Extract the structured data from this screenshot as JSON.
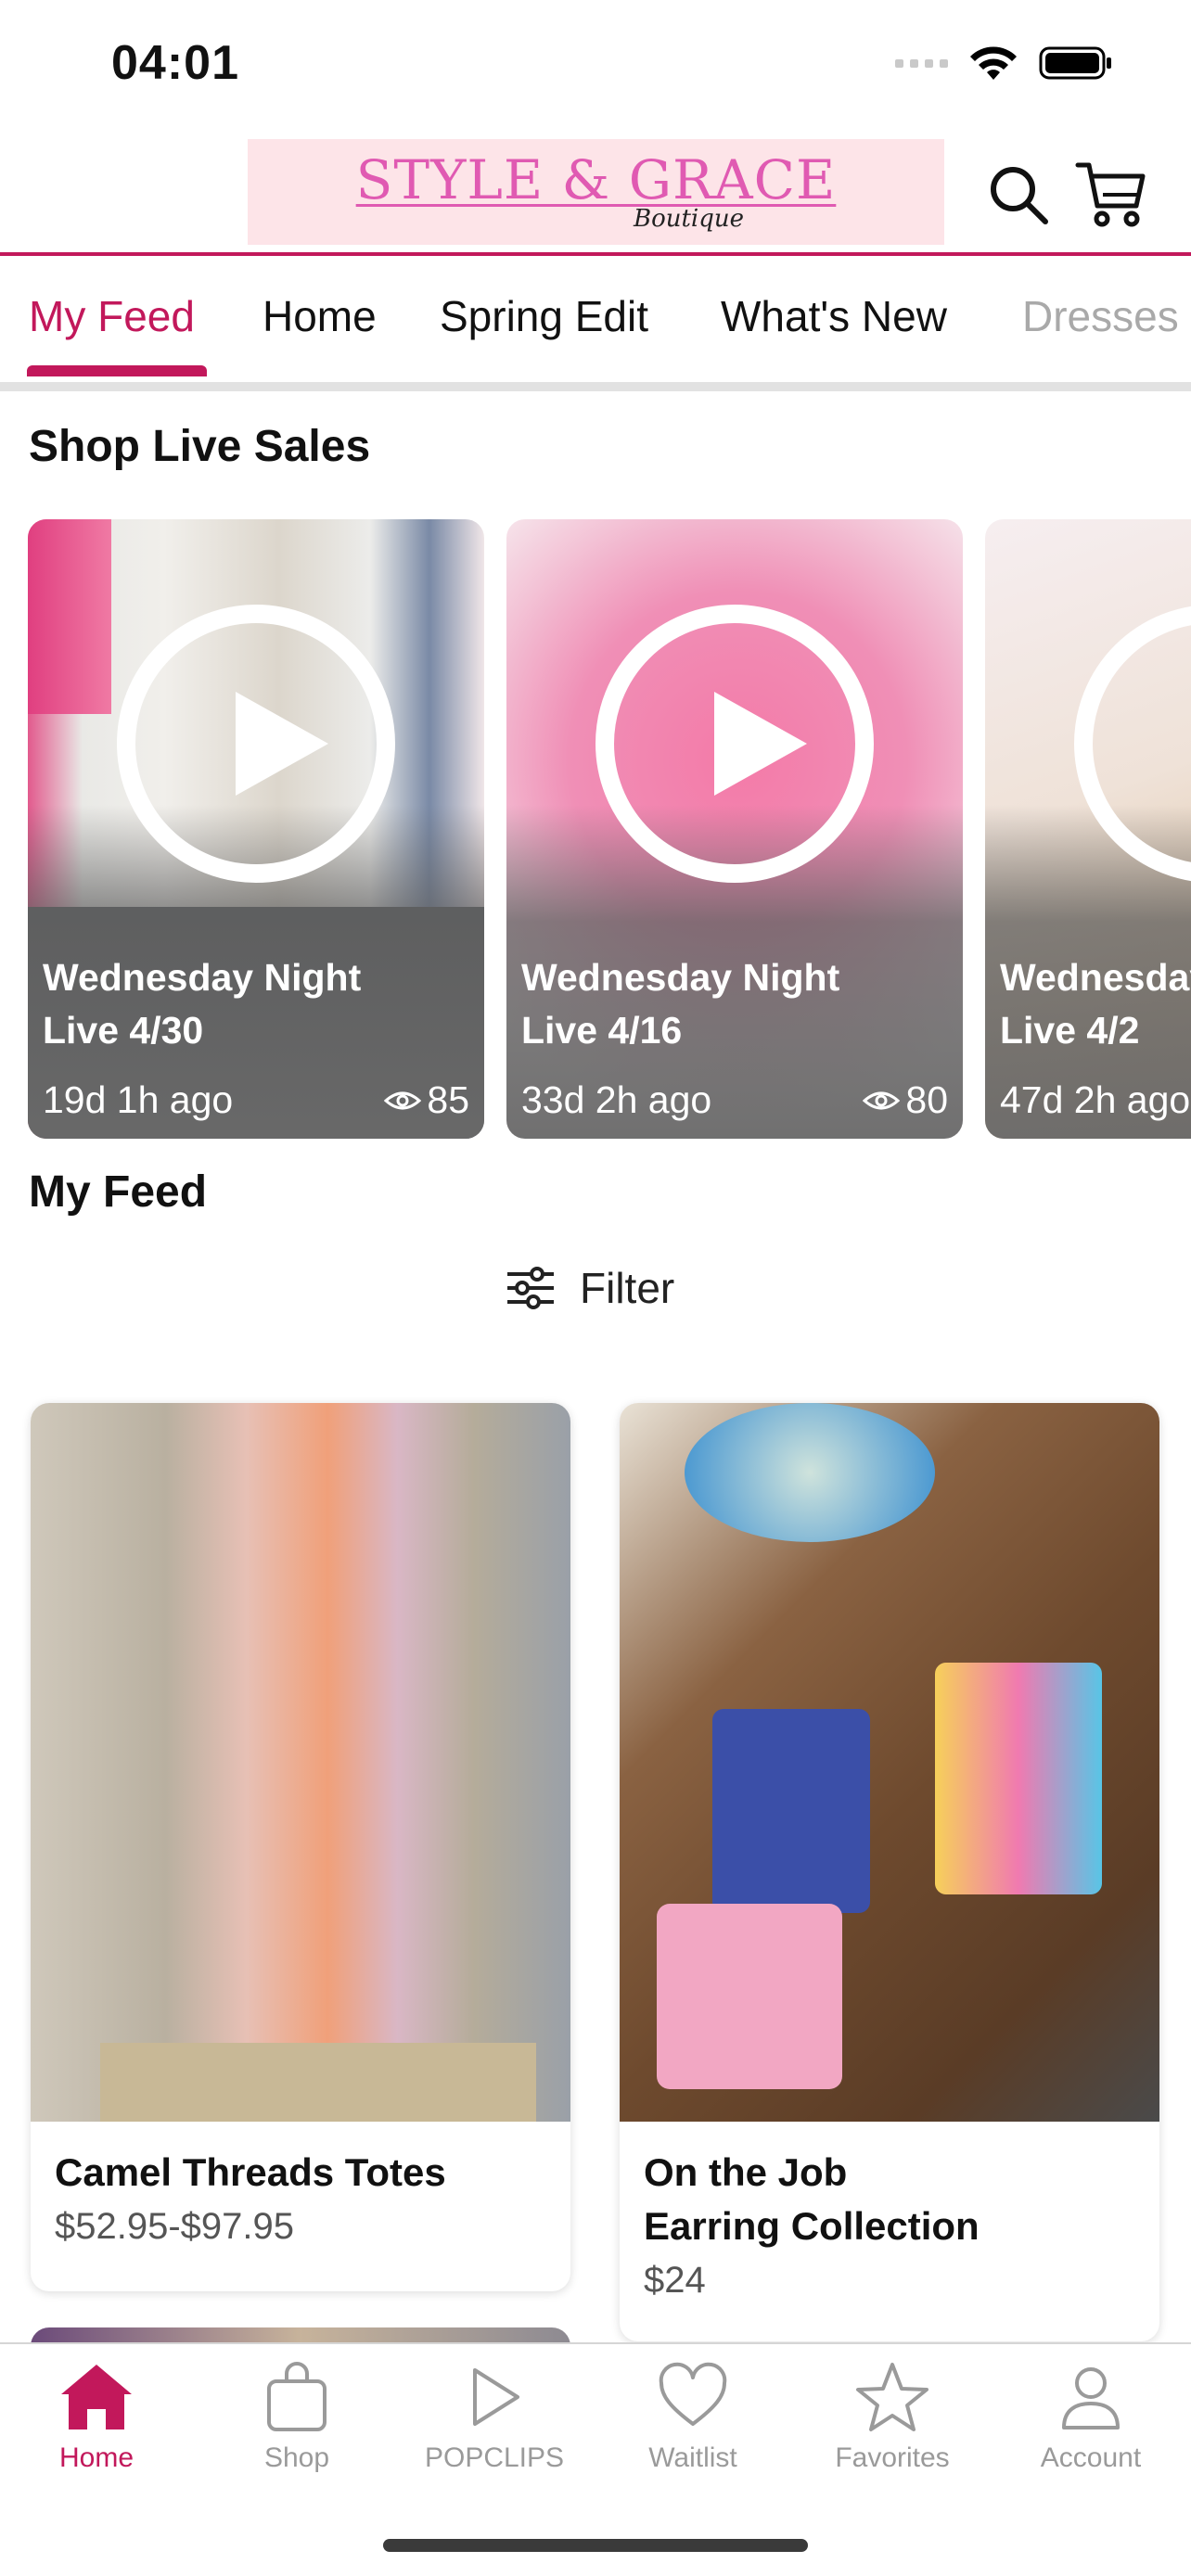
{
  "status_bar": {
    "time": "04:01"
  },
  "header": {
    "logo_main": "STYLE & GRACE",
    "logo_sub": "Boutique"
  },
  "tabs": [
    {
      "label": "My Feed"
    },
    {
      "label": "Home"
    },
    {
      "label": "Spring Edit"
    },
    {
      "label": "What's New"
    },
    {
      "label": "Dresses"
    }
  ],
  "live_sales": {
    "title": "Shop Live Sales",
    "items": [
      {
        "title_line1": "Wednesday Night",
        "title_line2": "Live 4/30",
        "ago": "19d 1h ago",
        "views": "85"
      },
      {
        "title_line1": "Wednesday Night",
        "title_line2": "Live 4/16",
        "ago": "33d 2h ago",
        "views": "80"
      },
      {
        "title_line1": "Wednesday Night",
        "title_line2": "Live 4/2",
        "ago": "47d 2h ago",
        "views": ""
      }
    ]
  },
  "feed": {
    "title": "My Feed",
    "filter_label": "Filter",
    "products": [
      {
        "name": "Camel Threads Totes",
        "price": "$52.95-$97.95"
      },
      {
        "name_line1": "On the Job",
        "name_line2": "Earring Collection",
        "price": "$24"
      }
    ]
  },
  "bottom_nav": {
    "items": [
      {
        "label": "Home",
        "icon": "home-icon"
      },
      {
        "label": "Shop",
        "icon": "shopping-bag-icon"
      },
      {
        "label": "POPCLIPS",
        "icon": "play-icon"
      },
      {
        "label": "Waitlist",
        "icon": "heart-icon"
      },
      {
        "label": "Favorites",
        "icon": "star-icon"
      },
      {
        "label": "Account",
        "icon": "account-icon"
      }
    ]
  },
  "colors": {
    "accent": "#c2185b",
    "logo_pink": "#e05ab2",
    "logo_bg": "#fde4e8"
  }
}
